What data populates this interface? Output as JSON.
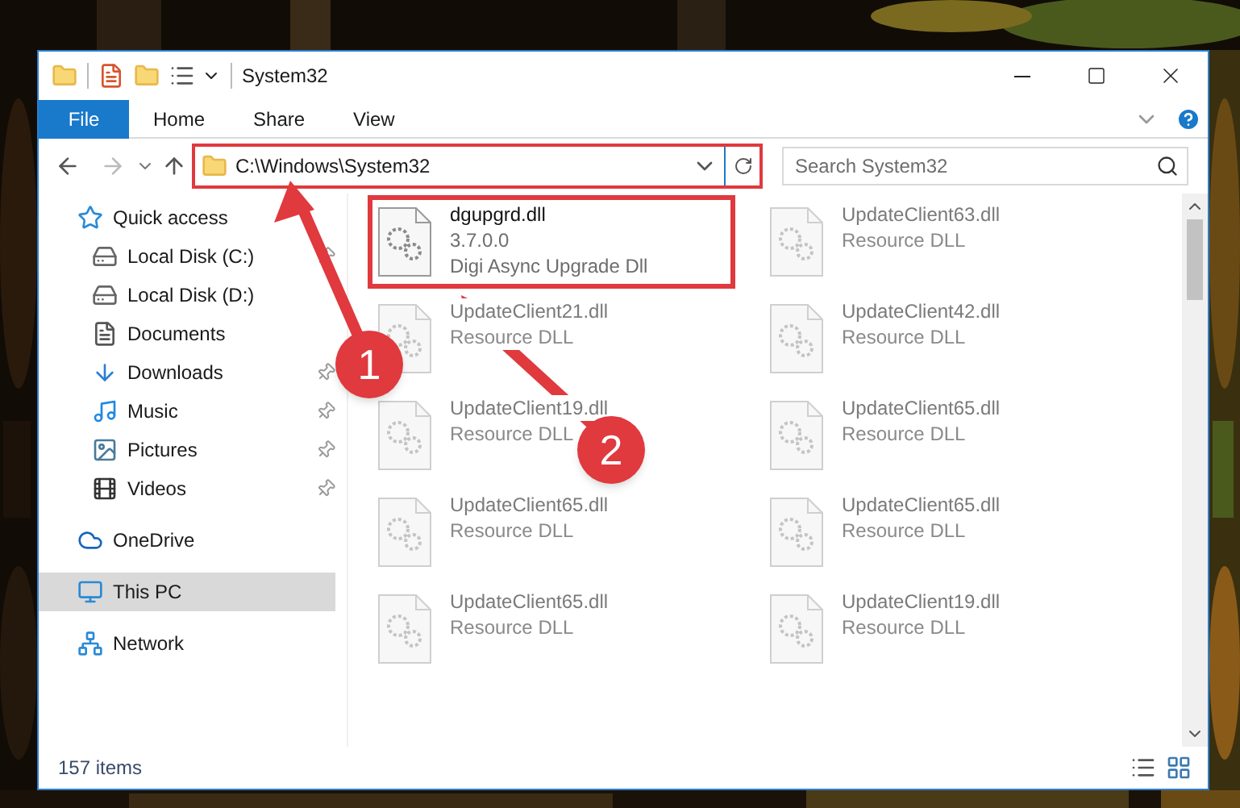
{
  "window": {
    "title": "System32"
  },
  "ribbon": {
    "tabs": [
      {
        "label": "File",
        "kind": "file"
      },
      {
        "label": "Home",
        "kind": "tab"
      },
      {
        "label": "Share",
        "kind": "tab"
      },
      {
        "label": "View",
        "kind": "tab"
      }
    ]
  },
  "address_bar": {
    "path": "C:\\Windows\\System32",
    "highlighted": true
  },
  "search": {
    "placeholder": "Search System32"
  },
  "sidebar": {
    "items": [
      {
        "label": "Quick access",
        "kind": "star",
        "selected": false,
        "children": [
          {
            "label": "Local Disk (C:)",
            "kind": "drive",
            "pinned": true
          },
          {
            "label": "Local Disk (D:)",
            "kind": "drive",
            "pinned": false
          },
          {
            "label": "Documents",
            "kind": "document",
            "pinned": false
          },
          {
            "label": "Downloads",
            "kind": "download",
            "pinned": true
          },
          {
            "label": "Music",
            "kind": "music",
            "pinned": true
          },
          {
            "label": "Pictures",
            "kind": "picture",
            "pinned": true
          },
          {
            "label": "Videos",
            "kind": "video",
            "pinned": true
          }
        ]
      },
      {
        "label": "OneDrive",
        "kind": "cloud",
        "selected": false
      },
      {
        "label": "This PC",
        "kind": "pc",
        "selected": true
      },
      {
        "label": "Network",
        "kind": "network",
        "selected": false
      }
    ]
  },
  "files": [
    {
      "name": "dgupgrd.dll",
      "details": [
        "3.7.0.0",
        "Digi Async Upgrade Dll"
      ],
      "blurred": false,
      "highlighted": true
    },
    {
      "name": "UpdateClient63.dll",
      "details": [
        "Resource DLL"
      ],
      "blurred": true,
      "highlighted": false
    },
    {
      "name": "UpdateClient21.dll",
      "details": [
        "Resource DLL"
      ],
      "blurred": true,
      "highlighted": false
    },
    {
      "name": "UpdateClient42.dll",
      "details": [
        "Resource DLL"
      ],
      "blurred": true,
      "highlighted": false
    },
    {
      "name": "UpdateClient19.dll",
      "details": [
        "Resource DLL"
      ],
      "blurred": true,
      "highlighted": false
    },
    {
      "name": "UpdateClient65.dll",
      "details": [
        "Resource DLL"
      ],
      "blurred": true,
      "highlighted": false
    },
    {
      "name": "UpdateClient65.dll",
      "details": [
        "Resource DLL"
      ],
      "blurred": true,
      "highlighted": false
    },
    {
      "name": "UpdateClient65.dll",
      "details": [
        "Resource DLL"
      ],
      "blurred": true,
      "highlighted": false
    },
    {
      "name": "UpdateClient65.dll",
      "details": [
        "Resource DLL"
      ],
      "blurred": true,
      "highlighted": false
    },
    {
      "name": "UpdateClient19.dll",
      "details": [
        "Resource DLL"
      ],
      "blurred": true,
      "highlighted": false
    }
  ],
  "status_bar": {
    "item_count": "157 items"
  },
  "callouts": [
    {
      "label": "1"
    },
    {
      "label": "2"
    }
  ]
}
